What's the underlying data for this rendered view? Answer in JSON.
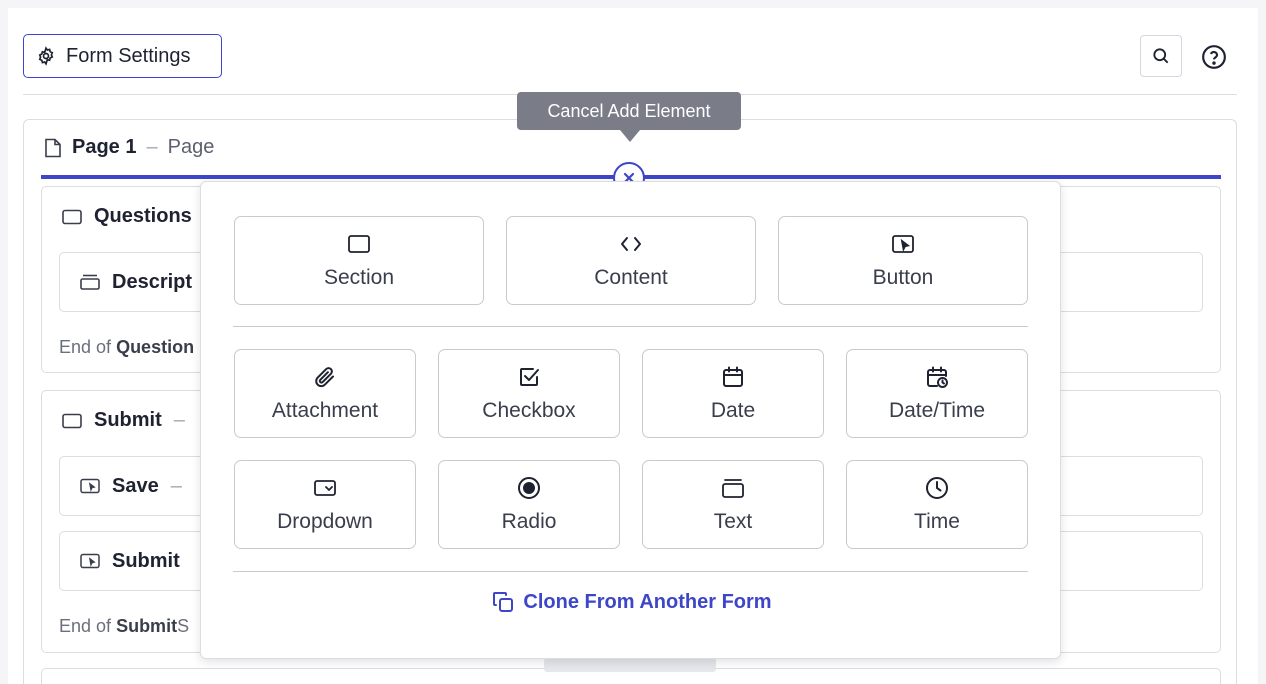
{
  "header": {
    "form_settings_label": "Form Settings"
  },
  "page": {
    "name": "Page 1",
    "dash": "–",
    "type": "Page"
  },
  "sections": [
    {
      "name": "Questions",
      "rows": [
        {
          "name": "Descript"
        }
      ],
      "end_prefix": "End of",
      "end_name": "Question"
    },
    {
      "name": "Submit",
      "dash": "–",
      "rows": [
        {
          "name": "Save",
          "dash": "–"
        },
        {
          "name": "Submit"
        }
      ],
      "end_prefix": "End of",
      "end_name": "Submit",
      "end_suffix": "S"
    }
  ],
  "tooltip": {
    "text": "Cancel Add Element"
  },
  "popover": {
    "top_row": [
      {
        "label": "Section",
        "icon": "section-icon"
      },
      {
        "label": "Content",
        "icon": "code-icon"
      },
      {
        "label": "Button",
        "icon": "button-icon"
      }
    ],
    "grid": [
      {
        "label": "Attachment",
        "icon": "paperclip-icon"
      },
      {
        "label": "Checkbox",
        "icon": "checkbox-icon"
      },
      {
        "label": "Date",
        "icon": "calendar-icon"
      },
      {
        "label": "Date/Time",
        "icon": "calendar-clock-icon"
      },
      {
        "label": "Dropdown",
        "icon": "dropdown-icon"
      },
      {
        "label": "Radio",
        "icon": "radio-icon"
      },
      {
        "label": "Text",
        "icon": "text-field-icon"
      },
      {
        "label": "Time",
        "icon": "clock-icon"
      }
    ],
    "clone_label": "Clone From Another Form"
  },
  "colors": {
    "accent": "#3d46c9",
    "tooltip_bg": "#7a7d88",
    "border": "#dcdde3"
  }
}
